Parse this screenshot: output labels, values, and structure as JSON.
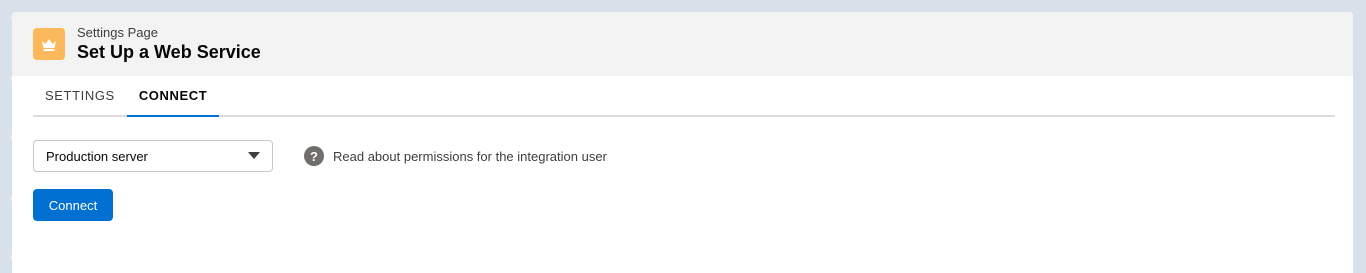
{
  "header": {
    "subtitle": "Settings Page",
    "title": "Set Up a Web Service",
    "icon": "crown-icon",
    "icon_color": "#fcb95b"
  },
  "tabs": [
    {
      "label": "SETTINGS",
      "active": false
    },
    {
      "label": "CONNECT",
      "active": true
    }
  ],
  "server_select": {
    "value": "Production server"
  },
  "help": {
    "icon": "question-icon",
    "icon_glyph": "?",
    "text": "Read about permissions for the integration user"
  },
  "connect_button": {
    "label": "Connect",
    "color": "#0070d2"
  }
}
